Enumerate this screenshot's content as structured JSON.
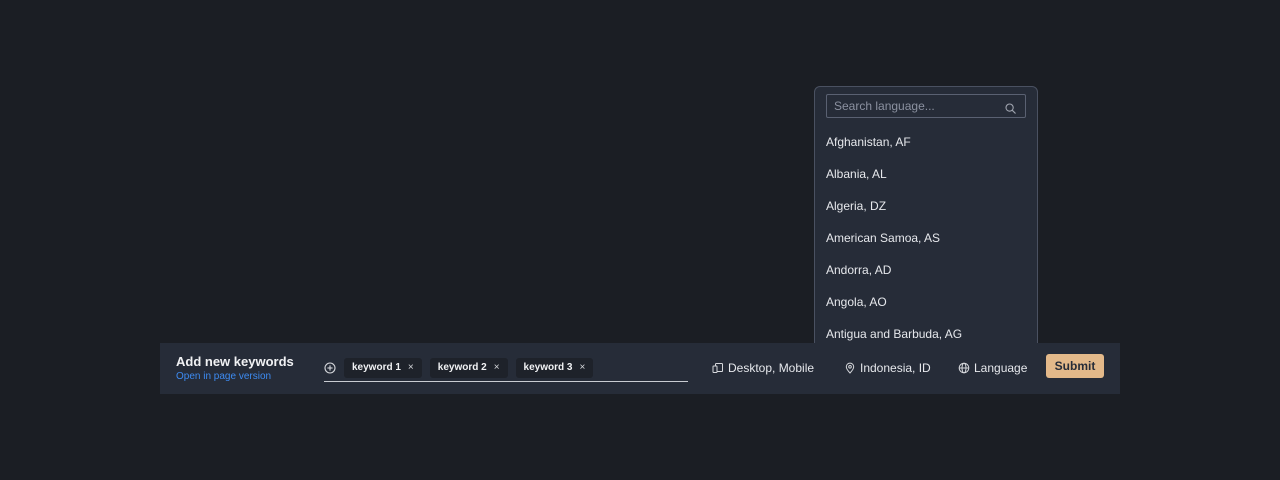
{
  "bar": {
    "title": "Add new keywords",
    "link": "Open in page version",
    "keywords": [
      {
        "label": "keyword 1",
        "remove": "×"
      },
      {
        "label": "keyword 2",
        "remove": "×"
      },
      {
        "label": "keyword 3",
        "remove": "×"
      }
    ],
    "device": "Desktop, Mobile",
    "country": "Indonesia, ID",
    "language": "Language",
    "submit": "Submit"
  },
  "dropdown": {
    "search_placeholder": "Search language...",
    "items": [
      "Afghanistan, AF",
      "Albania, AL",
      "Algeria, DZ",
      "American Samoa, AS",
      "Andorra, AD",
      "Angola, AO",
      "Antigua and Barbuda, AG"
    ]
  },
  "colors": {
    "background": "#1b1e24",
    "panel": "#262c38",
    "accent": "#e3b98a",
    "link": "#3d8bf2"
  }
}
